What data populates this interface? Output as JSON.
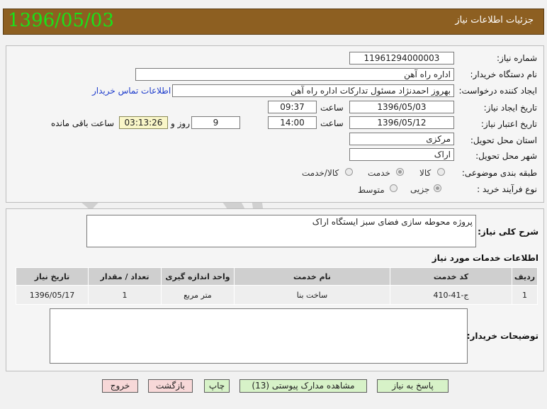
{
  "header": {
    "title": "جزئیات اطلاعات نیاز",
    "date": "1396/05/03"
  },
  "form": {
    "need_number": {
      "label": "شماره نیاز:",
      "value": "11961294000003"
    },
    "buyer_org": {
      "label": "نام دستگاه خریدار:",
      "value": "اداره راه آهن"
    },
    "requester": {
      "label": "ایجاد کننده درخواست:",
      "value": "بهروز احمدنژاد مسئول تدارکات اداره راه آهن",
      "link": "اطلاعات تماس خریدار"
    },
    "created": {
      "label": "تاریخ ایجاد نیاز:",
      "date": "1396/05/03",
      "time_label": "ساعت",
      "time": "09:37"
    },
    "validity": {
      "label": "تاریخ اعتبار نیاز:",
      "date": "1396/05/12",
      "time_label": "ساعت",
      "time": "14:00",
      "days": "9",
      "days_label": "روز و",
      "remaining": "03:13:26",
      "remaining_label": "ساعت باقی مانده"
    },
    "province": {
      "label": "استان محل تحویل:",
      "value": "مرکزی"
    },
    "city": {
      "label": "شهر محل تحویل:",
      "value": "اراک"
    },
    "category": {
      "label": "طبقه بندی موضوعی:",
      "options": [
        "کالا",
        "خدمت",
        "کالا/خدمت"
      ],
      "selected": "خدمت"
    },
    "process": {
      "label": "نوع فرآیند خرید :",
      "options": [
        "جزیی",
        "متوسط"
      ],
      "selected": "جزیی"
    }
  },
  "description": {
    "label": "شرح کلی نیاز:",
    "value": "پروژه محوطه سازی فضای سبز ایستگاه اراک"
  },
  "services": {
    "title": "اطلاعات خدمات مورد نیاز",
    "columns": [
      "ردیف",
      "کد خدمت",
      "نام خدمت",
      "واحد اندازه گیری",
      "تعداد / مقدار",
      "تاریخ نیاز"
    ],
    "rows": [
      {
        "row": "1",
        "code": "ج-41-410",
        "name": "ساخت بنا",
        "unit": "متر مربع",
        "qty": "1",
        "date": "1396/05/17"
      }
    ]
  },
  "buyer_notes": {
    "label": "توضیحات خریدار:",
    "value": ""
  },
  "buttons": {
    "reply": "پاسخ به نیاز",
    "attachments": "مشاهده مدارک پیوستی (13)",
    "print": "چاپ",
    "back": "بازگشت",
    "exit": "خروج"
  },
  "colors": {
    "header_bg": "#8d5f21",
    "date_green": "#19e219",
    "button_green": "#d7f2c8",
    "button_pink": "#f7d8d8"
  }
}
